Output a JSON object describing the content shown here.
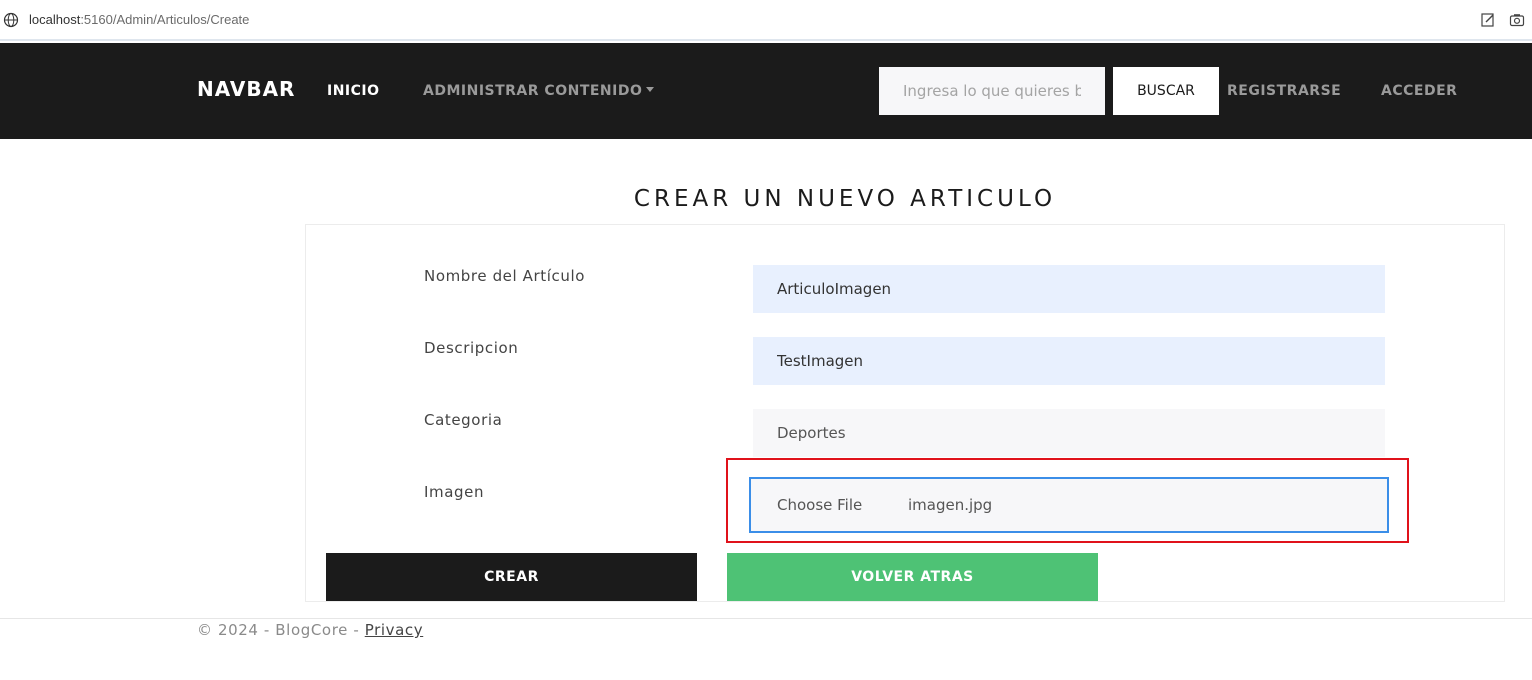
{
  "browser": {
    "url_host": "localhost",
    "url_rest": ":5160/Admin/Articulos/Create",
    "icons": [
      "globe-icon",
      "edit-page-icon",
      "screenshot-icon"
    ]
  },
  "navbar": {
    "brand": "NAVBAR",
    "inicio": "INICIO",
    "admin": "ADMINISTRAR CONTENIDO",
    "search_placeholder": "Ingresa lo que quieres buscar",
    "search_button": "BUSCAR",
    "registrarse": "REGISTRARSE",
    "acceder": "ACCEDER"
  },
  "form": {
    "title": "CREAR UN NUEVO ARTICULO",
    "nombre_label": "Nombre del Artículo",
    "nombre_value": "ArticuloImagen",
    "descripcion_label": "Descripcion",
    "descripcion_value": "TestImagen",
    "categoria_label": "Categoria",
    "categoria_value": "Deportes",
    "imagen_label": "Imagen",
    "file_button": "Choose File",
    "file_name": "imagen.jpg",
    "crear_button": "CREAR",
    "volver_button": "VOLVER ATRAS"
  },
  "footer": {
    "copyright": "© 2024 - BlogCore - ",
    "privacy": "Privacy"
  },
  "colors": {
    "navbar_bg": "#1b1b1b",
    "autofill_bg": "#e8f0fe",
    "success_green": "#4ec275",
    "focus_blue": "#3b8ee8",
    "highlight_red": "#e0121b"
  }
}
